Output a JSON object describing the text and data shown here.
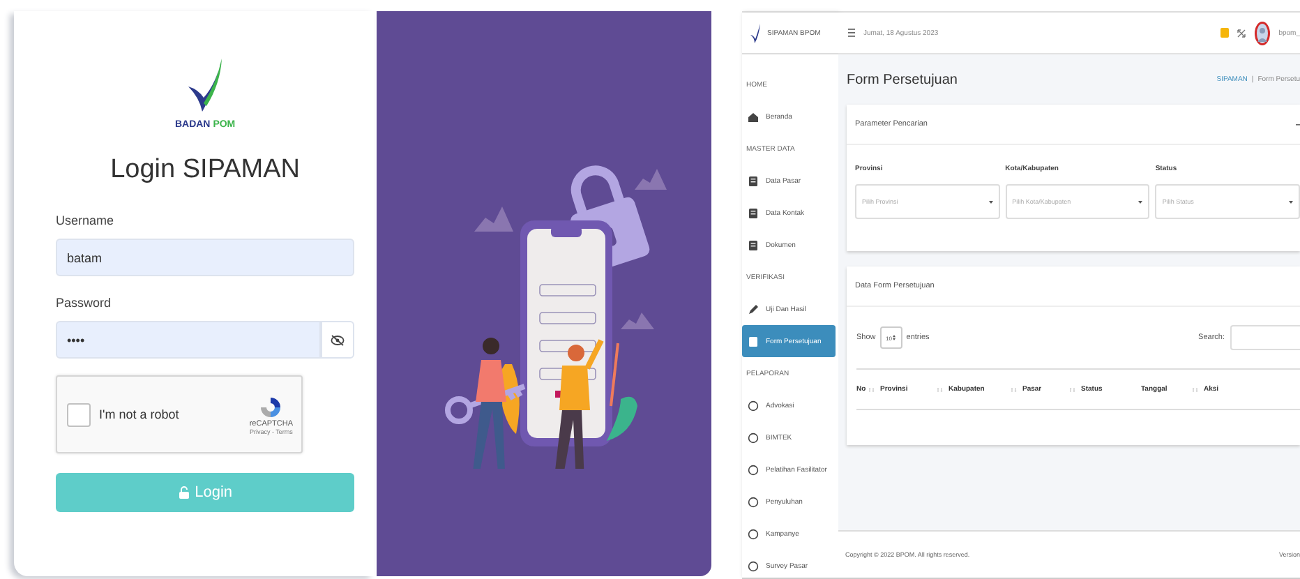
{
  "login": {
    "logo": {
      "word_1": "BADAN",
      "word_2": "POM"
    },
    "title": "Login SIPAMAN",
    "username": {
      "label": "Username",
      "value": "batam"
    },
    "password": {
      "label": "Password",
      "value": "••••"
    },
    "recaptcha": {
      "label": "I'm not a robot",
      "checked": false,
      "brand": "reCAPTCHA",
      "links": "Privacy - Terms"
    },
    "button": "Login"
  },
  "dashboard": {
    "brand": "SIPAMAN BPOM",
    "sidebar": {
      "items": [
        {
          "kind": "section",
          "label": "HOME"
        },
        {
          "kind": "home",
          "label": "Beranda",
          "selected": false
        },
        {
          "kind": "section",
          "label": "MASTER DATA"
        },
        {
          "kind": "page",
          "label": "Data Pasar",
          "selected": false
        },
        {
          "kind": "page",
          "label": "Data Kontak",
          "selected": false
        },
        {
          "kind": "page",
          "label": "Dokumen",
          "selected": false
        },
        {
          "kind": "section",
          "label": "VERIFIKASI"
        },
        {
          "kind": "edit",
          "label": "Uji Dan Hasil",
          "selected": false
        },
        {
          "kind": "page",
          "label": "Form Persetujuan",
          "selected": true
        },
        {
          "kind": "section",
          "label": "PELAPORAN"
        },
        {
          "kind": "report",
          "label": "Advokasi",
          "selected": false
        },
        {
          "kind": "report",
          "label": "BIMTEK",
          "selected": false
        },
        {
          "kind": "report",
          "label": "Pelatihan Fasilitator",
          "selected": false
        },
        {
          "kind": "report",
          "label": "Penyuluhan",
          "selected": false
        },
        {
          "kind": "report",
          "label": "Kampanye",
          "selected": false
        },
        {
          "kind": "report",
          "label": "Survey Pasar",
          "selected": false
        }
      ]
    },
    "topbar": {
      "date": "Jumat, 18 Agustus 2023",
      "user": "bpom_"
    },
    "page_title": "Form Persetujuan",
    "breadcrumb": {
      "root": "SIPAMAN",
      "separator": "|",
      "current": "Form Persetu"
    },
    "filter_card": {
      "title": "Parameter Pencarian",
      "fields": [
        {
          "label": "Provinsi",
          "placeholder": "Pilih Provinsi"
        },
        {
          "label": "Kota/Kabupaten",
          "placeholder": "Pilih Kota/Kabupaten"
        },
        {
          "label": "Status",
          "placeholder": "Pilih Status"
        }
      ]
    },
    "table_card": {
      "title": "Data Form Persetujuan",
      "show": "Show",
      "length": "10",
      "entries": "entries",
      "search_label": "Search:",
      "columns": [
        {
          "label": "No",
          "sortable": true
        },
        {
          "label": "Provinsi",
          "sortable": true
        },
        {
          "label": "Kabupaten",
          "sortable": true
        },
        {
          "label": "Pasar",
          "sortable": true
        },
        {
          "label": "Status",
          "sortable": false
        },
        {
          "label": "Tanggal",
          "sortable": true
        },
        {
          "label": "Aksi",
          "sortable": false
        }
      ]
    },
    "footer": {
      "copyright": "Copyright © 2022 BPOM. All rights reserved.",
      "version": "Version"
    }
  }
}
